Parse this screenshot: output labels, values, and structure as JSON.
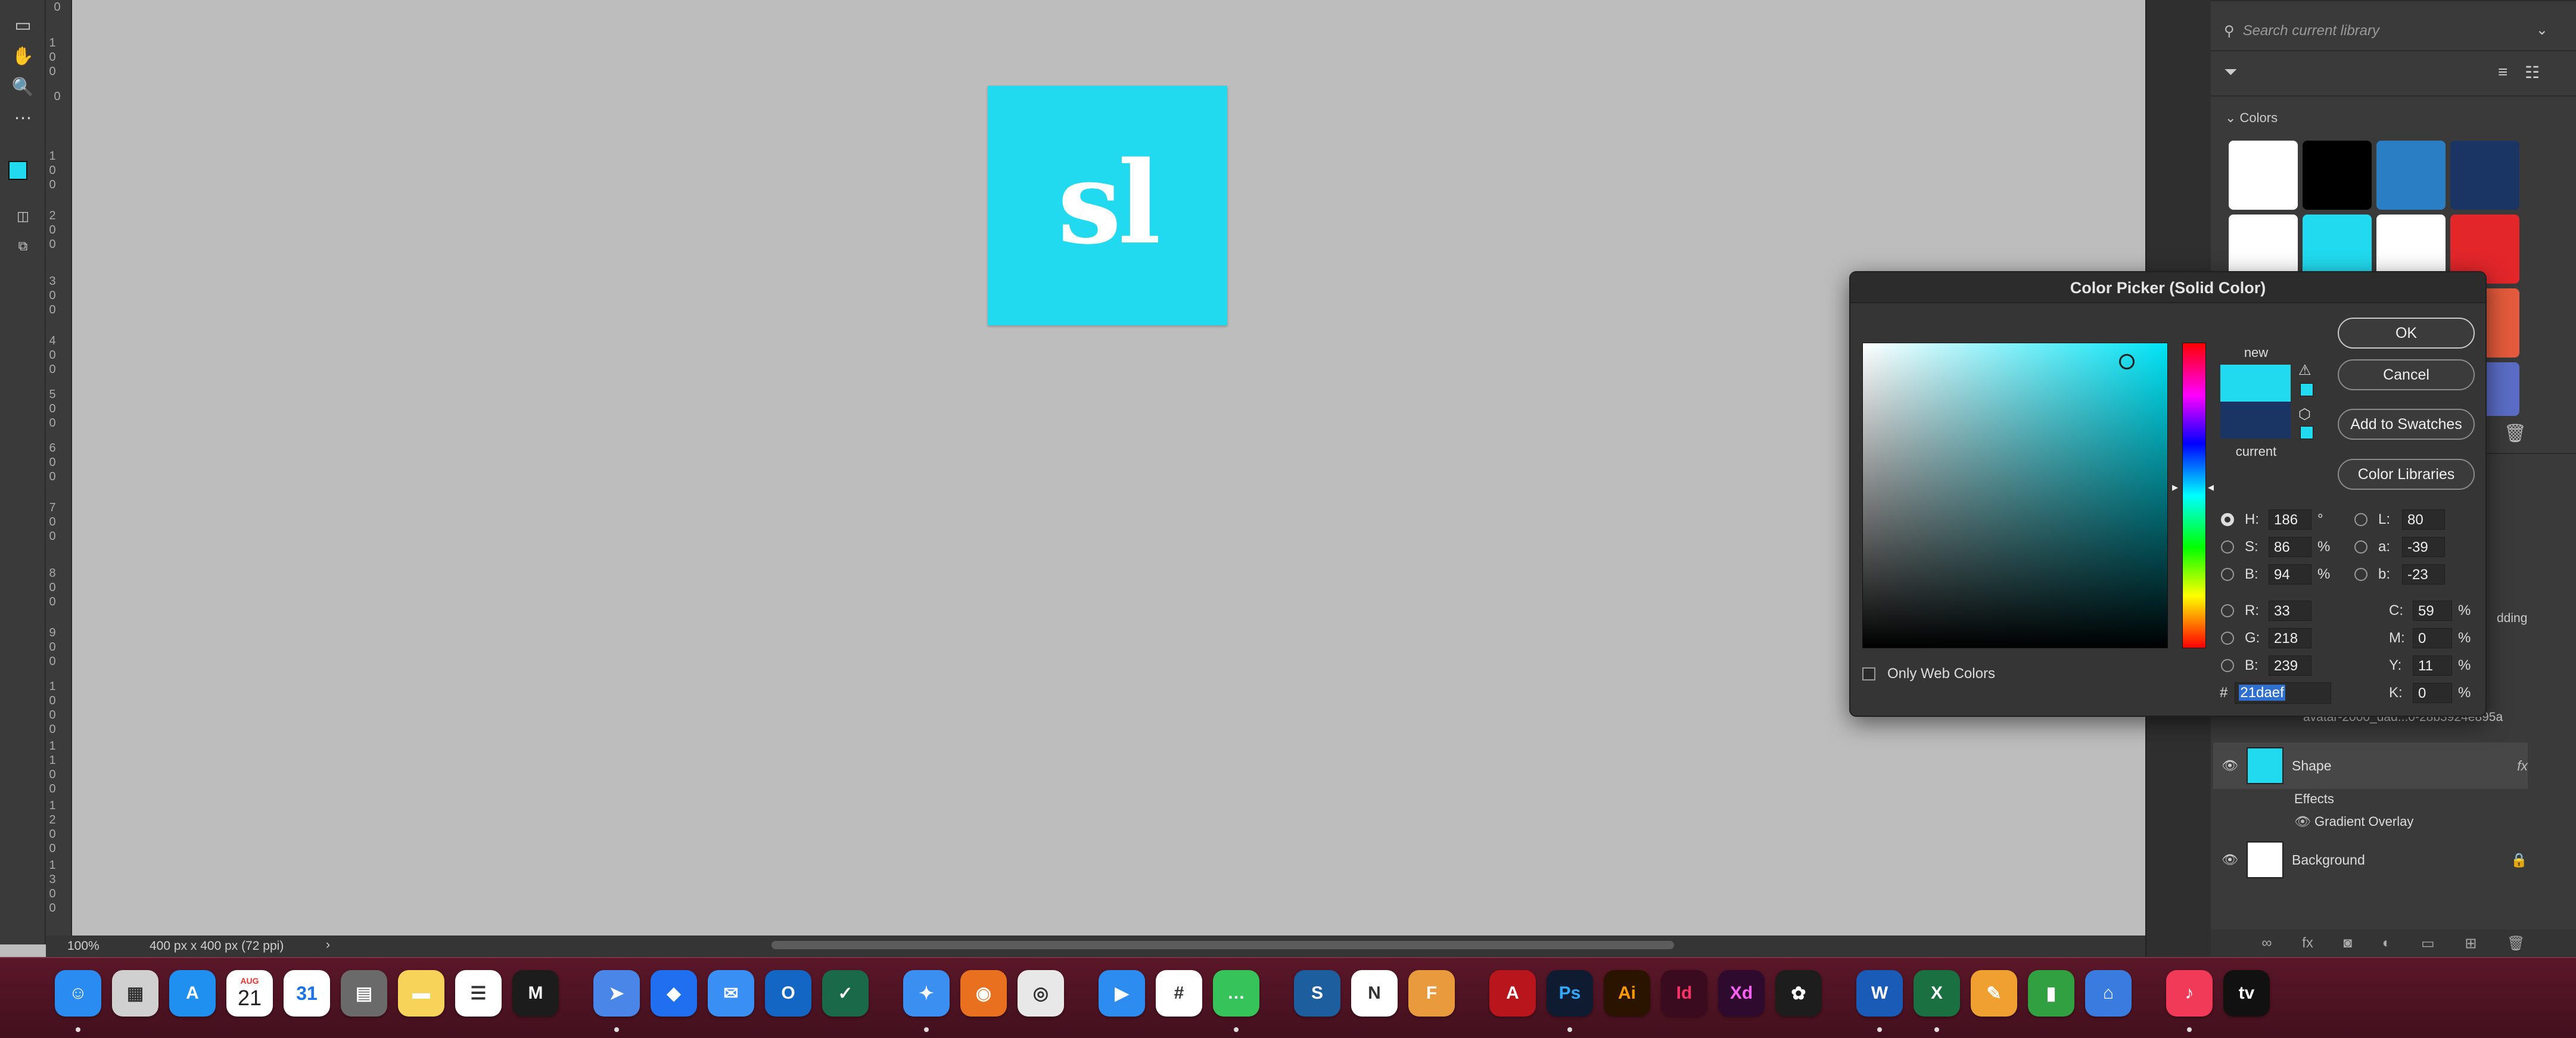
{
  "canvas": {
    "artwork_text": "sl",
    "artwork_color": "#21daef"
  },
  "status_bar": {
    "zoom": "100%",
    "doc_info": "400 px x 400 px (72 ppi)",
    "arrow": "›"
  },
  "ruler": {
    "ticks": [
      "0",
      "1 0 0",
      "0",
      "1 0 0",
      "2 0 0",
      "3 0 0",
      "4 0 0",
      "5 0 0",
      "6 0 0",
      "7 0 0",
      "8 0 0",
      "9 0 0",
      "1 0 0 0",
      "1 1 0 0",
      "1 2 0 0",
      "1 3 0 0"
    ]
  },
  "libraries": {
    "search_placeholder": "Search current library",
    "colors_label": "Colors",
    "swatches": [
      "#ffffff",
      "#000000",
      "#2a7fc4",
      "#1a3464",
      "#ffffff",
      "#21daef",
      "#ffffff",
      "#e2262a",
      "#ffffff",
      "#21daef",
      "#ffffff",
      "#e45a3c",
      "#ffffff",
      "#21daef",
      "#ffffff",
      "#5b6cc6"
    ]
  },
  "layers": {
    "partial_right_text": "dding",
    "partial_layer_name": "avatar-2000_dad...0-28b3924e895a",
    "shape": "Shape",
    "fx": "fx",
    "effects": "Effects",
    "gradient_overlay": "Gradient Overlay",
    "background": "Background"
  },
  "color_picker": {
    "title": "Color Picker (Solid Color)",
    "new_label": "new",
    "current_label": "current",
    "new_color": "#21daef",
    "current_color": "#1a3464",
    "buttons": {
      "ok": "OK",
      "cancel": "Cancel",
      "add_to_swatches": "Add to Swatches",
      "color_libraries": "Color Libraries"
    },
    "hsb": {
      "h_label": "H:",
      "h": "186",
      "h_unit": "°",
      "s_label": "S:",
      "s": "86",
      "s_unit": "%",
      "b_label": "B:",
      "b": "94",
      "b_unit": "%"
    },
    "rgb": {
      "r_label": "R:",
      "r": "33",
      "g_label": "G:",
      "g": "218",
      "b_label": "B:",
      "b": "239"
    },
    "lab": {
      "l_label": "L:",
      "l": "80",
      "a_label": "a:",
      "a": "-39",
      "b_label": "b:",
      "b": "-23"
    },
    "cmyk": {
      "c_label": "C:",
      "c": "59",
      "c_unit": "%",
      "m_label": "M:",
      "m": "0",
      "m_unit": "%",
      "y_label": "Y:",
      "y": "11",
      "y_unit": "%",
      "k_label": "K:",
      "k": "0",
      "k_unit": "%"
    },
    "only_web_colors": "Only Web Colors",
    "hex_symbol": "#",
    "hex": "21daef"
  },
  "dock": {
    "calendar_month": "AUG",
    "calendar_day": "21",
    "gcal_day": "31",
    "apps": [
      {
        "name": "finder",
        "label": "☺",
        "color": "#2a8cf0"
      },
      {
        "name": "launchpad",
        "label": "▦",
        "color": "#d0d0d0"
      },
      {
        "name": "app-store",
        "label": "A",
        "color": "#1f8ff0"
      },
      {
        "name": "calendar",
        "label": "",
        "color": "#ffffff"
      },
      {
        "name": "google-calendar",
        "label": "",
        "color": "#ffffff"
      },
      {
        "name": "calculator",
        "label": "▤",
        "color": "#6a6a6a"
      },
      {
        "name": "notes",
        "label": "▬",
        "color": "#f7d35a"
      },
      {
        "name": "reminders",
        "label": "☰",
        "color": "#ffffff"
      },
      {
        "name": "mimestream",
        "label": "M",
        "color": "#1c1c1c"
      },
      {
        "name": "maps-arrow",
        "label": "➤",
        "color": "#4a86e8"
      },
      {
        "name": "dropbox",
        "label": "◆",
        "color": "#1f6ff0"
      },
      {
        "name": "mail",
        "label": "✉",
        "color": "#3a8ff5"
      },
      {
        "name": "outlook",
        "label": "O",
        "color": "#1366c4"
      },
      {
        "name": "vectorworks",
        "label": "✓",
        "color": "#1a6a4a"
      },
      {
        "name": "safari",
        "label": "✦",
        "color": "#3b8ff0"
      },
      {
        "name": "firefox",
        "label": "◉",
        "color": "#e8701f"
      },
      {
        "name": "chrome",
        "label": "◎",
        "color": "#e8e8e8"
      },
      {
        "name": "zoom",
        "label": "▶",
        "color": "#2d8cf0"
      },
      {
        "name": "slack",
        "label": "#",
        "color": "#ffffff"
      },
      {
        "name": "messages",
        "label": "…",
        "color": "#36c35a"
      },
      {
        "name": "sketchup",
        "label": "S",
        "color": "#1d5e9e"
      },
      {
        "name": "notion",
        "label": "N",
        "color": "#ffffff"
      },
      {
        "name": "fusion",
        "label": "F",
        "color": "#e89a3c"
      },
      {
        "name": "acrobat",
        "label": "A",
        "color": "#b8161c"
      },
      {
        "name": "photoshop",
        "label": "Ps",
        "color": "#0f1b30"
      },
      {
        "name": "illustrator",
        "label": "Ai",
        "color": "#2a1400"
      },
      {
        "name": "indesign",
        "label": "Id",
        "color": "#3a0a1e"
      },
      {
        "name": "xd",
        "label": "Xd",
        "color": "#2e0a2e"
      },
      {
        "name": "figma",
        "label": "✿",
        "color": "#1d1d1d"
      },
      {
        "name": "word",
        "label": "W",
        "color": "#1a5bb8"
      },
      {
        "name": "excel",
        "label": "X",
        "color": "#1a7040"
      },
      {
        "name": "pages-pen",
        "label": "✎",
        "color": "#f0a030"
      },
      {
        "name": "numbers",
        "label": "▮",
        "color": "#30a040"
      },
      {
        "name": "keynote",
        "label": "⌂",
        "color": "#3a7be0"
      },
      {
        "name": "music",
        "label": "♪",
        "color": "#f03a58"
      },
      {
        "name": "tv",
        "label": "tv",
        "color": "#111111"
      }
    ]
  }
}
